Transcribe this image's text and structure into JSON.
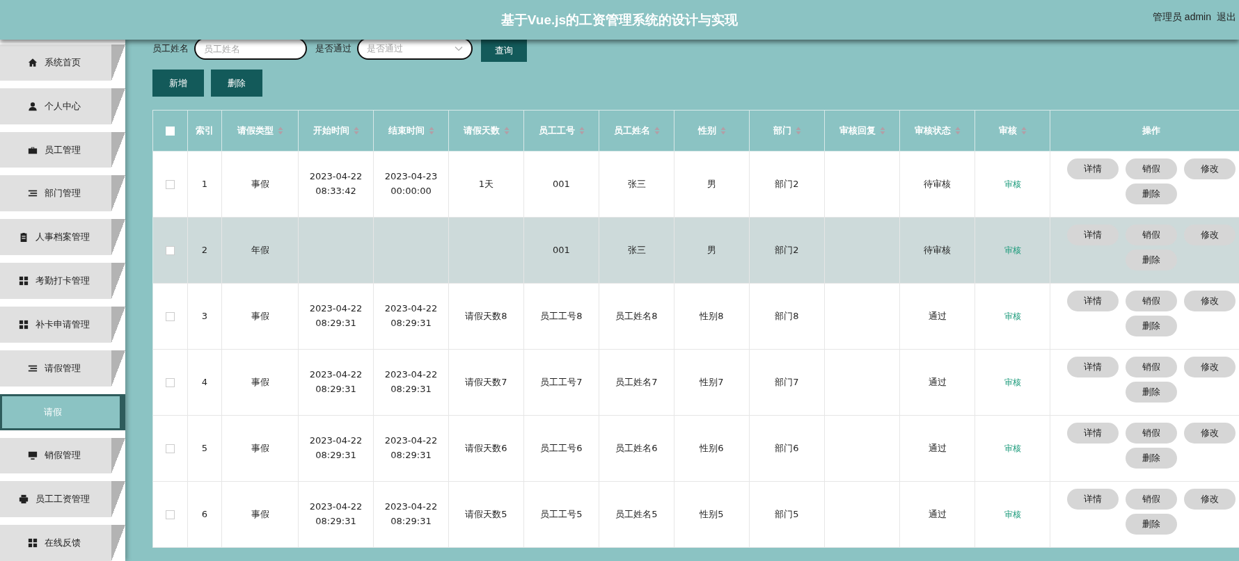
{
  "header": {
    "title": "基于Vue.js的工资管理系统的设计与实现",
    "user": "管理员 admin",
    "logout": "退出"
  },
  "sidebar": {
    "items": [
      {
        "label": "系统首页",
        "kind": "menu",
        "selected": false
      },
      {
        "label": "个人中心",
        "kind": "menu",
        "selected": false
      },
      {
        "label": "员工管理",
        "kind": "menu",
        "selected": false
      },
      {
        "label": "部门管理",
        "kind": "menu",
        "selected": false
      },
      {
        "label": "人事档案管理",
        "kind": "menu",
        "selected": false
      },
      {
        "label": "考勤打卡管理",
        "kind": "menu",
        "selected": false
      },
      {
        "label": "补卡申请管理",
        "kind": "menu",
        "selected": false
      },
      {
        "label": "请假管理",
        "kind": "menu",
        "selected": false
      },
      {
        "label": "请假",
        "kind": "sub",
        "selected": true
      },
      {
        "label": "销假管理",
        "kind": "menu",
        "selected": false
      },
      {
        "label": "员工工资管理",
        "kind": "menu",
        "selected": false
      },
      {
        "label": "在线反馈",
        "kind": "menu",
        "selected": false
      }
    ]
  },
  "filters": [
    {
      "label": "员工姓名",
      "kind": "text",
      "placeholder": "员工姓名"
    },
    {
      "label": "是否通过",
      "kind": "select",
      "placeholder": "是否通过"
    }
  ],
  "search_button": "查询",
  "actions": [
    "新增",
    "删除"
  ],
  "table": {
    "select_all": {
      "checked": false
    },
    "columns": [
      {
        "label": "索引",
        "sortable": false
      },
      {
        "label": "请假类型",
        "sortable": true
      },
      {
        "label": "开始时间",
        "sortable": true
      },
      {
        "label": "结束时间",
        "sortable": true
      },
      {
        "label": "请假天数",
        "sortable": true
      },
      {
        "label": "员工工号",
        "sortable": true
      },
      {
        "label": "员工姓名",
        "sortable": true
      },
      {
        "label": "性别",
        "sortable": true
      },
      {
        "label": "部门",
        "sortable": true
      },
      {
        "label": "审核回复",
        "sortable": true
      },
      {
        "label": "审核状态",
        "sortable": true
      },
      {
        "label": "审核",
        "sortable": true
      },
      {
        "label": "操作",
        "sortable": false
      }
    ],
    "rows": [
      {
        "checked": false,
        "hovered": false,
        "cells": [
          "1",
          "事假",
          "2023-04-22 08:33:42",
          "2023-04-23 00:00:00",
          "1天",
          "001",
          "张三",
          "男",
          "部门2",
          null,
          "待审核"
        ],
        "review_link": "审核",
        "buttons": [
          "详情",
          "销假",
          "修改",
          "删除"
        ]
      },
      {
        "checked": false,
        "hovered": true,
        "cells": [
          "2",
          "年假",
          null,
          null,
          null,
          "001",
          "张三",
          "男",
          "部门2",
          null,
          "待审核"
        ],
        "review_link": "审核",
        "buttons": [
          "详情",
          "销假",
          "修改",
          "删除"
        ]
      },
      {
        "checked": false,
        "hovered": false,
        "cells": [
          "3",
          "事假",
          "2023-04-22 08:29:31",
          "2023-04-22 08:29:31",
          "请假天数8",
          "员工工号8",
          "员工姓名8",
          "性别8",
          "部门8",
          null,
          "通过"
        ],
        "review_link": "审核",
        "buttons": [
          "详情",
          "销假",
          "修改",
          "删除"
        ]
      },
      {
        "checked": false,
        "hovered": false,
        "cells": [
          "4",
          "事假",
          "2023-04-22 08:29:31",
          "2023-04-22 08:29:31",
          "请假天数7",
          "员工工号7",
          "员工姓名7",
          "性别7",
          "部门7",
          null,
          "通过"
        ],
        "review_link": "审核",
        "buttons": [
          "详情",
          "销假",
          "修改",
          "删除"
        ]
      },
      {
        "checked": false,
        "hovered": false,
        "cells": [
          "5",
          "事假",
          "2023-04-22 08:29:31",
          "2023-04-22 08:29:31",
          "请假天数6",
          "员工工号6",
          "员工姓名6",
          "性别6",
          "部门6",
          null,
          "通过"
        ],
        "review_link": "审核",
        "buttons": [
          "详情",
          "销假",
          "修改",
          "删除"
        ]
      },
      {
        "checked": false,
        "hovered": false,
        "cells": [
          "6",
          "事假",
          "2023-04-22 08:29:31",
          "2023-04-22 08:29:31",
          "请假天数5",
          "员工工号5",
          "员工姓名5",
          "性别5",
          "部门5",
          null,
          "通过"
        ],
        "review_link": "审核",
        "buttons": [
          "详情",
          "销假",
          "修改",
          "删除"
        ]
      }
    ]
  }
}
